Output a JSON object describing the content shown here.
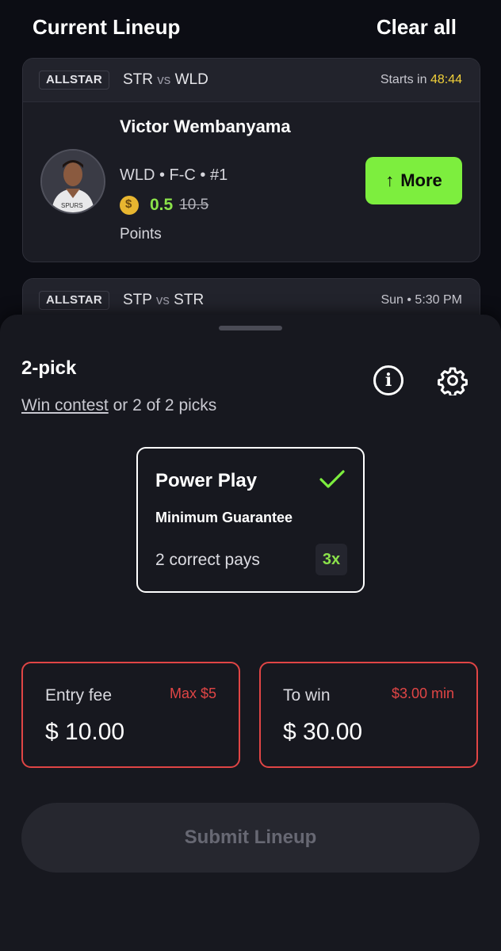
{
  "header": {
    "title": "Current Lineup",
    "clear_label": "Clear all"
  },
  "lineup": [
    {
      "tag": "ALLSTAR",
      "team_a": "STR",
      "vs": "vs",
      "team_b": "WLD",
      "starts_prefix": "Starts in",
      "starts_time": "48:44",
      "player": {
        "name": "Victor Wembanyama",
        "info": "WLD • F-C • #1",
        "line": "0.5",
        "old_line": "10.5",
        "stat": "Points"
      },
      "action_label": "More"
    },
    {
      "tag": "ALLSTAR",
      "team_a": "STP",
      "vs": "vs",
      "team_b": "STR",
      "schedule": "Sun • 5:30 PM"
    }
  ],
  "sheet": {
    "title": "2-pick",
    "sub_link": "Win contest",
    "sub_rest": "or 2 of 2 picks",
    "power_play": {
      "title": "Power Play",
      "subtitle": "Minimum Guarantee",
      "pays": "2 correct pays",
      "multiplier": "3x"
    },
    "entry": {
      "label": "Entry fee",
      "note": "Max $5",
      "value": "$ 10.00"
    },
    "win": {
      "label": "To win",
      "note": "$3.00 min",
      "value": "$ 30.00"
    },
    "submit_label": "Submit Lineup"
  },
  "colors": {
    "accent_green": "#7dee3e",
    "warning_red": "#e04545",
    "timer_yellow": "#f2d13a",
    "background": "#0c0d14"
  },
  "icons": [
    "coin-icon",
    "arrow-up-icon",
    "info-icon",
    "gear-icon",
    "check-icon"
  ]
}
